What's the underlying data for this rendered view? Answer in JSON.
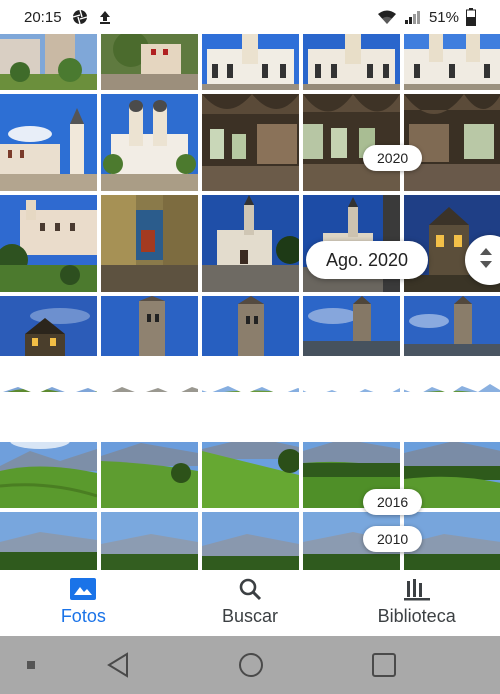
{
  "status_bar": {
    "time": "20:15",
    "battery_text": "51%",
    "icons": [
      "aperture-icon",
      "upload-icon",
      "wifi-icon",
      "signal-icon",
      "battery-icon"
    ]
  },
  "date_pills": {
    "year_2020": "2020",
    "month_label": "Ago. 2020",
    "year_2016": "2016",
    "year_2010": "2010"
  },
  "bottom_nav": {
    "items": [
      {
        "label": "Fotos",
        "icon": "photo-icon",
        "active": true
      },
      {
        "label": "Buscar",
        "icon": "search-icon",
        "active": false
      },
      {
        "label": "Biblioteca",
        "icon": "library-icon",
        "active": false
      }
    ]
  },
  "system_nav": {
    "buttons": [
      "recents-dot",
      "back-icon",
      "home-icon",
      "overview-icon"
    ]
  },
  "colors": {
    "accent": "#1a73e8",
    "nav_bar": "#a9a9a9",
    "sky_blue": "#2f72d6",
    "grass_green": "#5d9e32"
  }
}
